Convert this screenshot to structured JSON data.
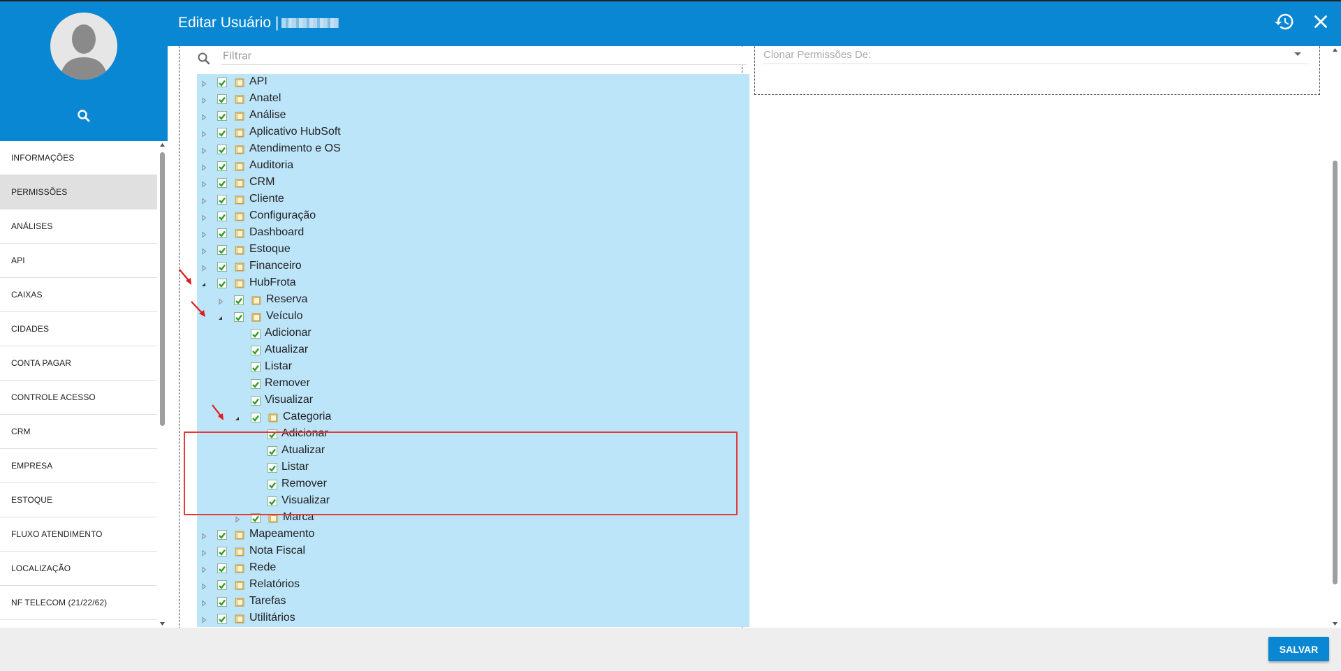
{
  "header": {
    "title": "Editar Usuário |"
  },
  "sidebar": {
    "items": [
      {
        "label": "INFORMAÇÕES",
        "active": false
      },
      {
        "label": "PERMISSÕES",
        "active": true
      },
      {
        "label": "ANÁLISES",
        "active": false
      },
      {
        "label": "API",
        "active": false
      },
      {
        "label": "CAIXAS",
        "active": false
      },
      {
        "label": "CIDADES",
        "active": false
      },
      {
        "label": "CONTA PAGAR",
        "active": false
      },
      {
        "label": "CONTROLE ACESSO",
        "active": false
      },
      {
        "label": "CRM",
        "active": false
      },
      {
        "label": "EMPRESA",
        "active": false
      },
      {
        "label": "ESTOQUE",
        "active": false
      },
      {
        "label": "FLUXO ATENDIMENTO",
        "active": false
      },
      {
        "label": "LOCALIZAÇÃO",
        "active": false
      },
      {
        "label": "NF TELECOM (21/22/62)",
        "active": false
      }
    ]
  },
  "filter": {
    "placeholder": "Filtrar"
  },
  "clone": {
    "placeholder": "Clonar Permissões De:"
  },
  "tree": [
    {
      "label": "API",
      "depth": 0,
      "folder": true,
      "expanded": false
    },
    {
      "label": "Anatel",
      "depth": 0,
      "folder": true,
      "expanded": false
    },
    {
      "label": "Análise",
      "depth": 0,
      "folder": true,
      "expanded": false
    },
    {
      "label": "Aplicativo HubSoft",
      "depth": 0,
      "folder": true,
      "expanded": false
    },
    {
      "label": "Atendimento e OS",
      "depth": 0,
      "folder": true,
      "expanded": false
    },
    {
      "label": "Auditoria",
      "depth": 0,
      "folder": true,
      "expanded": false
    },
    {
      "label": "CRM",
      "depth": 0,
      "folder": true,
      "expanded": false
    },
    {
      "label": "Cliente",
      "depth": 0,
      "folder": true,
      "expanded": false
    },
    {
      "label": "Configuração",
      "depth": 0,
      "folder": true,
      "expanded": false
    },
    {
      "label": "Dashboard",
      "depth": 0,
      "folder": true,
      "expanded": false
    },
    {
      "label": "Estoque",
      "depth": 0,
      "folder": true,
      "expanded": false
    },
    {
      "label": "Financeiro",
      "depth": 0,
      "folder": true,
      "expanded": false
    },
    {
      "label": "HubFrota",
      "depth": 0,
      "folder": true,
      "expanded": true
    },
    {
      "label": "Reserva",
      "depth": 1,
      "folder": true,
      "expanded": false
    },
    {
      "label": "Veículo",
      "depth": 1,
      "folder": true,
      "expanded": true
    },
    {
      "label": "Adicionar",
      "depth": 2,
      "folder": false
    },
    {
      "label": "Atualizar",
      "depth": 2,
      "folder": false
    },
    {
      "label": "Listar",
      "depth": 2,
      "folder": false
    },
    {
      "label": "Remover",
      "depth": 2,
      "folder": false
    },
    {
      "label": "Visualizar",
      "depth": 2,
      "folder": false
    },
    {
      "label": "Categoria",
      "depth": 2,
      "folder": true,
      "expanded": true
    },
    {
      "label": "Adicionar",
      "depth": 3,
      "folder": false
    },
    {
      "label": "Atualizar",
      "depth": 3,
      "folder": false
    },
    {
      "label": "Listar",
      "depth": 3,
      "folder": false
    },
    {
      "label": "Remover",
      "depth": 3,
      "folder": false
    },
    {
      "label": "Visualizar",
      "depth": 3,
      "folder": false
    },
    {
      "label": "Marca",
      "depth": 2,
      "folder": true,
      "expanded": false
    },
    {
      "label": "Mapeamento",
      "depth": 0,
      "folder": true,
      "expanded": false
    },
    {
      "label": "Nota Fiscal",
      "depth": 0,
      "folder": true,
      "expanded": false
    },
    {
      "label": "Rede",
      "depth": 0,
      "folder": true,
      "expanded": false
    },
    {
      "label": "Relatórios",
      "depth": 0,
      "folder": true,
      "expanded": false
    },
    {
      "label": "Tarefas",
      "depth": 0,
      "folder": true,
      "expanded": false
    },
    {
      "label": "Utilitários",
      "depth": 0,
      "folder": true,
      "expanded": false
    }
  ],
  "footer": {
    "save_label": "SALVAR"
  },
  "colors": {
    "primary": "#0a87d2",
    "tree_row": "#bde5fa",
    "check_green": "#2e9d2e",
    "highlight_red": "#e53935"
  }
}
